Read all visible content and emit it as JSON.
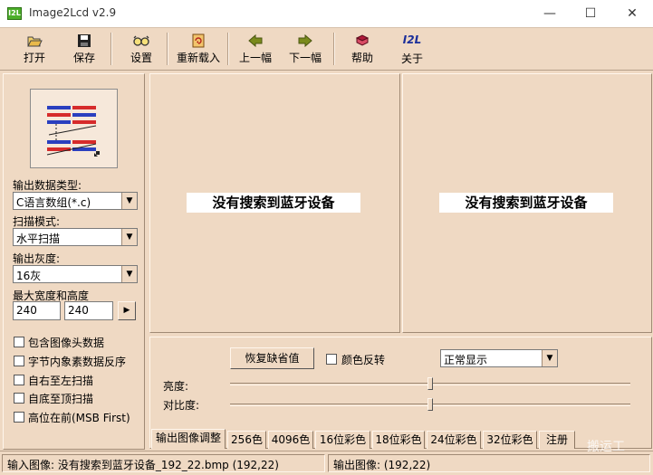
{
  "window": {
    "title": "Image2Lcd v2.9",
    "icon_text": "I2L",
    "minimize_glyph": "—",
    "maximize_glyph": "☐",
    "close_glyph": "✕"
  },
  "toolbar": {
    "open_label": "打开",
    "save_label": "保存",
    "settings_label": "设置",
    "reload_label": "重新载入",
    "prev_label": "上一幅",
    "next_label": "下一幅",
    "help_label": "帮助",
    "about_label": "关于",
    "about_icon_text": "I2L"
  },
  "left": {
    "output_type_label": "输出数据类型:",
    "output_type_value": "C语言数组(*.c)",
    "scan_mode_label": "扫描模式:",
    "scan_mode_value": "水平扫描",
    "gray_label": "输出灰度:",
    "gray_value": "16灰",
    "max_size_label": "最大宽度和高度",
    "max_width": "240",
    "max_height": "240",
    "arrow_glyph": "▶",
    "dropdown_glyph": "▼",
    "options": [
      {
        "label": "包含图像头数据",
        "checked": false
      },
      {
        "label": "字节内象素数据反序",
        "checked": false
      },
      {
        "label": "自右至左扫描",
        "checked": false
      },
      {
        "label": "自底至顶扫描",
        "checked": false
      },
      {
        "label": "高位在前(MSB First)",
        "checked": false
      }
    ]
  },
  "preview": {
    "input_message": "没有搜索到蓝牙设备",
    "output_message": "没有搜索到蓝牙设备"
  },
  "adjust": {
    "restore_label": "恢复缺省值",
    "invert_label": "颜色反转",
    "invert_checked": false,
    "display_mode_value": "正常显示",
    "brightness_label": "亮度:",
    "contrast_label": "对比度:",
    "brightness_level": 0.5,
    "contrast_level": 0.5
  },
  "tabs": [
    "输出图像调整",
    "256色",
    "4096色",
    "16位彩色",
    "18位彩色",
    "24位彩色",
    "32位彩色",
    "注册"
  ],
  "status": {
    "input": "输入图像: 没有搜索到蓝牙设备_192_22.bmp (192,22)",
    "output": "输出图像: (192,22)"
  },
  "watermark": "搬运工",
  "colors": {
    "background": "#efd9c3",
    "message_box": "#ffffff",
    "scan_red": "#d62b2b",
    "scan_blue": "#2a3fbf"
  }
}
